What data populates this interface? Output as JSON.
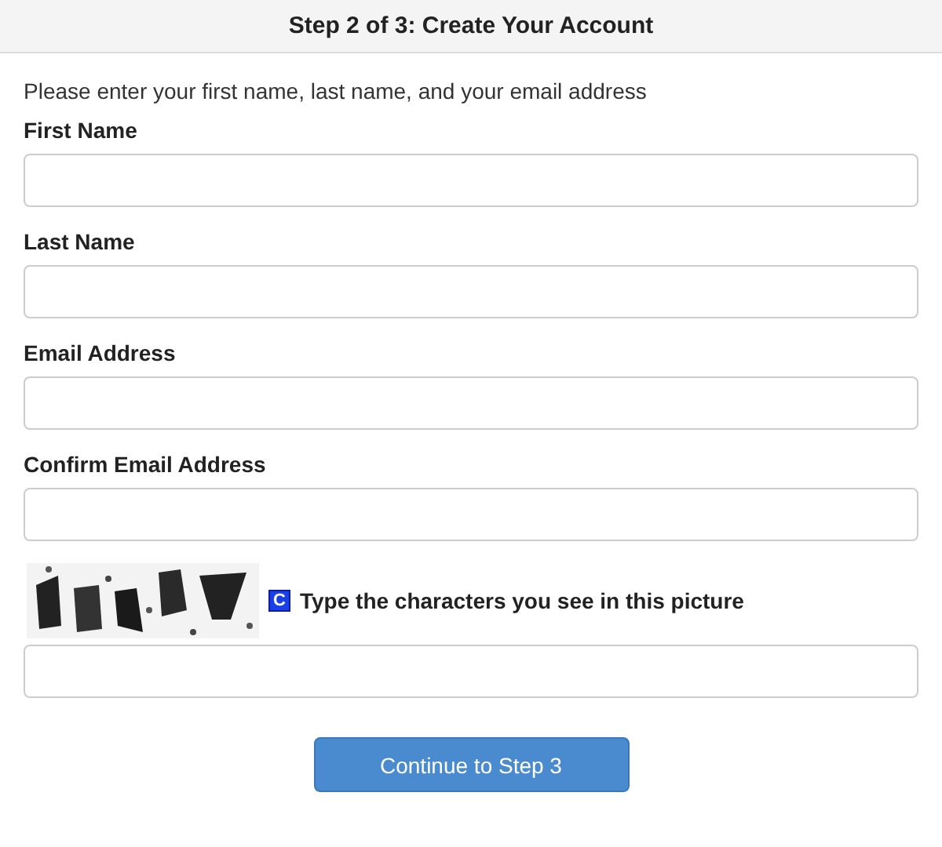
{
  "header": {
    "title": "Step 2 of 3: Create Your Account"
  },
  "intro": "Please enter your first name, last name, and your email address",
  "fields": [
    {
      "label": "First Name"
    },
    {
      "label": "Last Name"
    },
    {
      "label": "Email Address"
    },
    {
      "label": "Confirm Email Address"
    }
  ],
  "captcha": {
    "kind": "picture",
    "refresh_icon": "C",
    "instruction": "Type the characters you see in this picture"
  },
  "button": "Continue to Step 3"
}
